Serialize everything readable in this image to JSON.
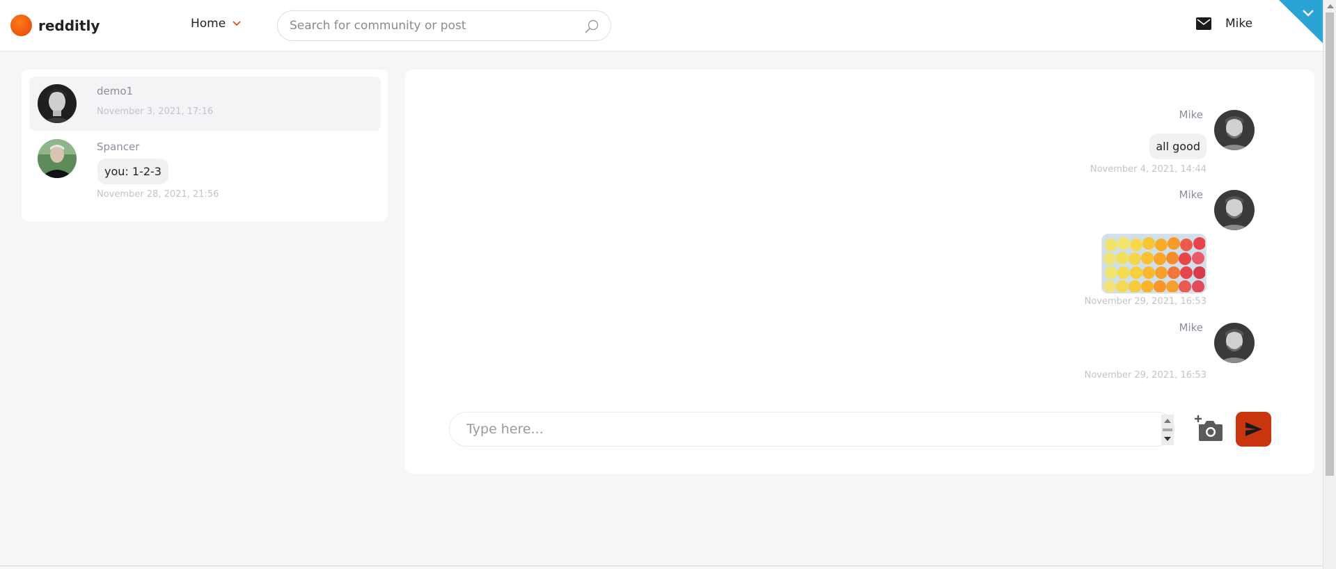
{
  "app": {
    "name": "redditly",
    "accent": "#e4440a"
  },
  "header": {
    "nav_label": "Home",
    "search": {
      "placeholder": "Search for community or post",
      "icon": "search-icon"
    },
    "user_name": "Mike",
    "mail_icon": "mail-icon"
  },
  "conversations": [
    {
      "name": "demo1",
      "preview": "",
      "time": "November 3, 2021, 17:16",
      "active": true
    },
    {
      "name": "Spancer",
      "preview": "you: 1-2-3",
      "time": "November 28, 2021, 21:56",
      "active": false
    }
  ],
  "messages": [
    {
      "sender": "Mike",
      "type": "text",
      "text": "all good",
      "time": "November 4, 2021, 14:44"
    },
    {
      "sender": "Mike",
      "type": "image",
      "image": "citrus-slices-photo",
      "time": "November 29, 2021, 16:53"
    },
    {
      "sender": "Mike",
      "type": "empty",
      "time": "November 29, 2021, 16:53"
    }
  ],
  "composer": {
    "placeholder": "Type here...",
    "value": "",
    "attach_icon": "add-photo-icon",
    "send_icon": "send-icon"
  },
  "colors": {
    "send_button": "#c9350f",
    "corner_ribbon": "#2aa3d6"
  }
}
